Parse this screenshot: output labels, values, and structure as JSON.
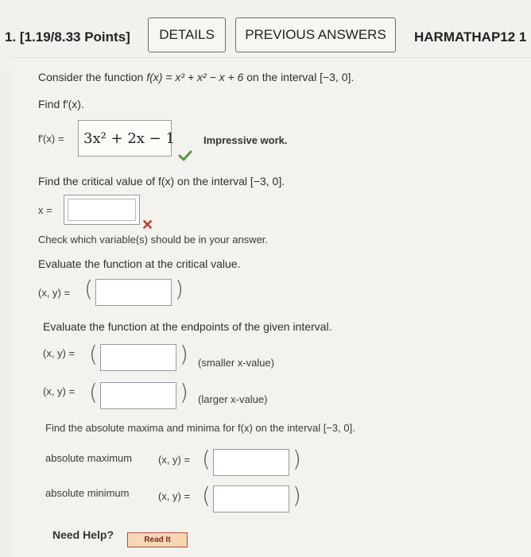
{
  "header": {
    "question_number": "1.",
    "points": "[1.19/8.33 Points]",
    "details_button": "DETAILS",
    "previous_answers_button": "PREVIOUS ANSWERS",
    "assignment_code": "HARMATHAP12 1"
  },
  "problem": {
    "intro_text": "Consider the function ",
    "function_expr": "f(x) = x³ + x² − x + 6",
    "interval_text": " on the interval [−3, 0].",
    "find_derivative_prompt": "Find f′(x).",
    "derivative_label": "f′(x) =",
    "derivative_answer": "3x² + 2x − 1",
    "derivative_feedback": "Impressive work.",
    "critical_prompt": "Find the critical value of f(x) on the interval [−3, 0].",
    "critical_label": "x =",
    "critical_value": "",
    "critical_error": "Check which variable(s) should be in your answer.",
    "eval_critical_prompt": "Evaluate the function at the critical value.",
    "point_label": "(x, y) =",
    "eval_critical_value": "",
    "eval_endpoints_prompt": "Evaluate the function at the endpoints of the given interval.",
    "endpoint_smaller_value": "",
    "endpoint_smaller_note": "(smaller x-value)",
    "endpoint_larger_value": "",
    "endpoint_larger_note": "(larger x-value)",
    "absolute_prompt": "Find the absolute maxima and minima for f(x) on the interval [−3, 0].",
    "absolute_max_label": "absolute maximum",
    "absolute_max_value": "",
    "absolute_min_label": "absolute minimum",
    "absolute_min_value": ""
  },
  "help": {
    "need_help": "Need Help?",
    "read_it": "Read It"
  },
  "colors": {
    "correct": "#5a9a3a",
    "incorrect": "#c0392b"
  }
}
